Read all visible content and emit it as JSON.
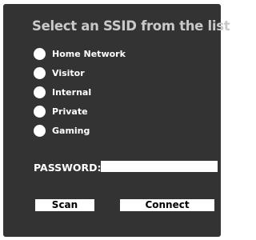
{
  "title": "Select an SSID from the list",
  "ssids": [
    {
      "label": "Home Network"
    },
    {
      "label": "Visitor"
    },
    {
      "label": "Internal"
    },
    {
      "label": "Private"
    },
    {
      "label": "Gaming"
    }
  ],
  "password": {
    "label": "PASSWORD:",
    "value": "",
    "placeholder": ""
  },
  "buttons": {
    "scan_label": "Scan",
    "connect_label": "Connect"
  },
  "colors": {
    "panel_background": "#333333",
    "title_text": "#c9c9c9",
    "label_text": "#ffffff",
    "control_background": "#ffffff"
  }
}
